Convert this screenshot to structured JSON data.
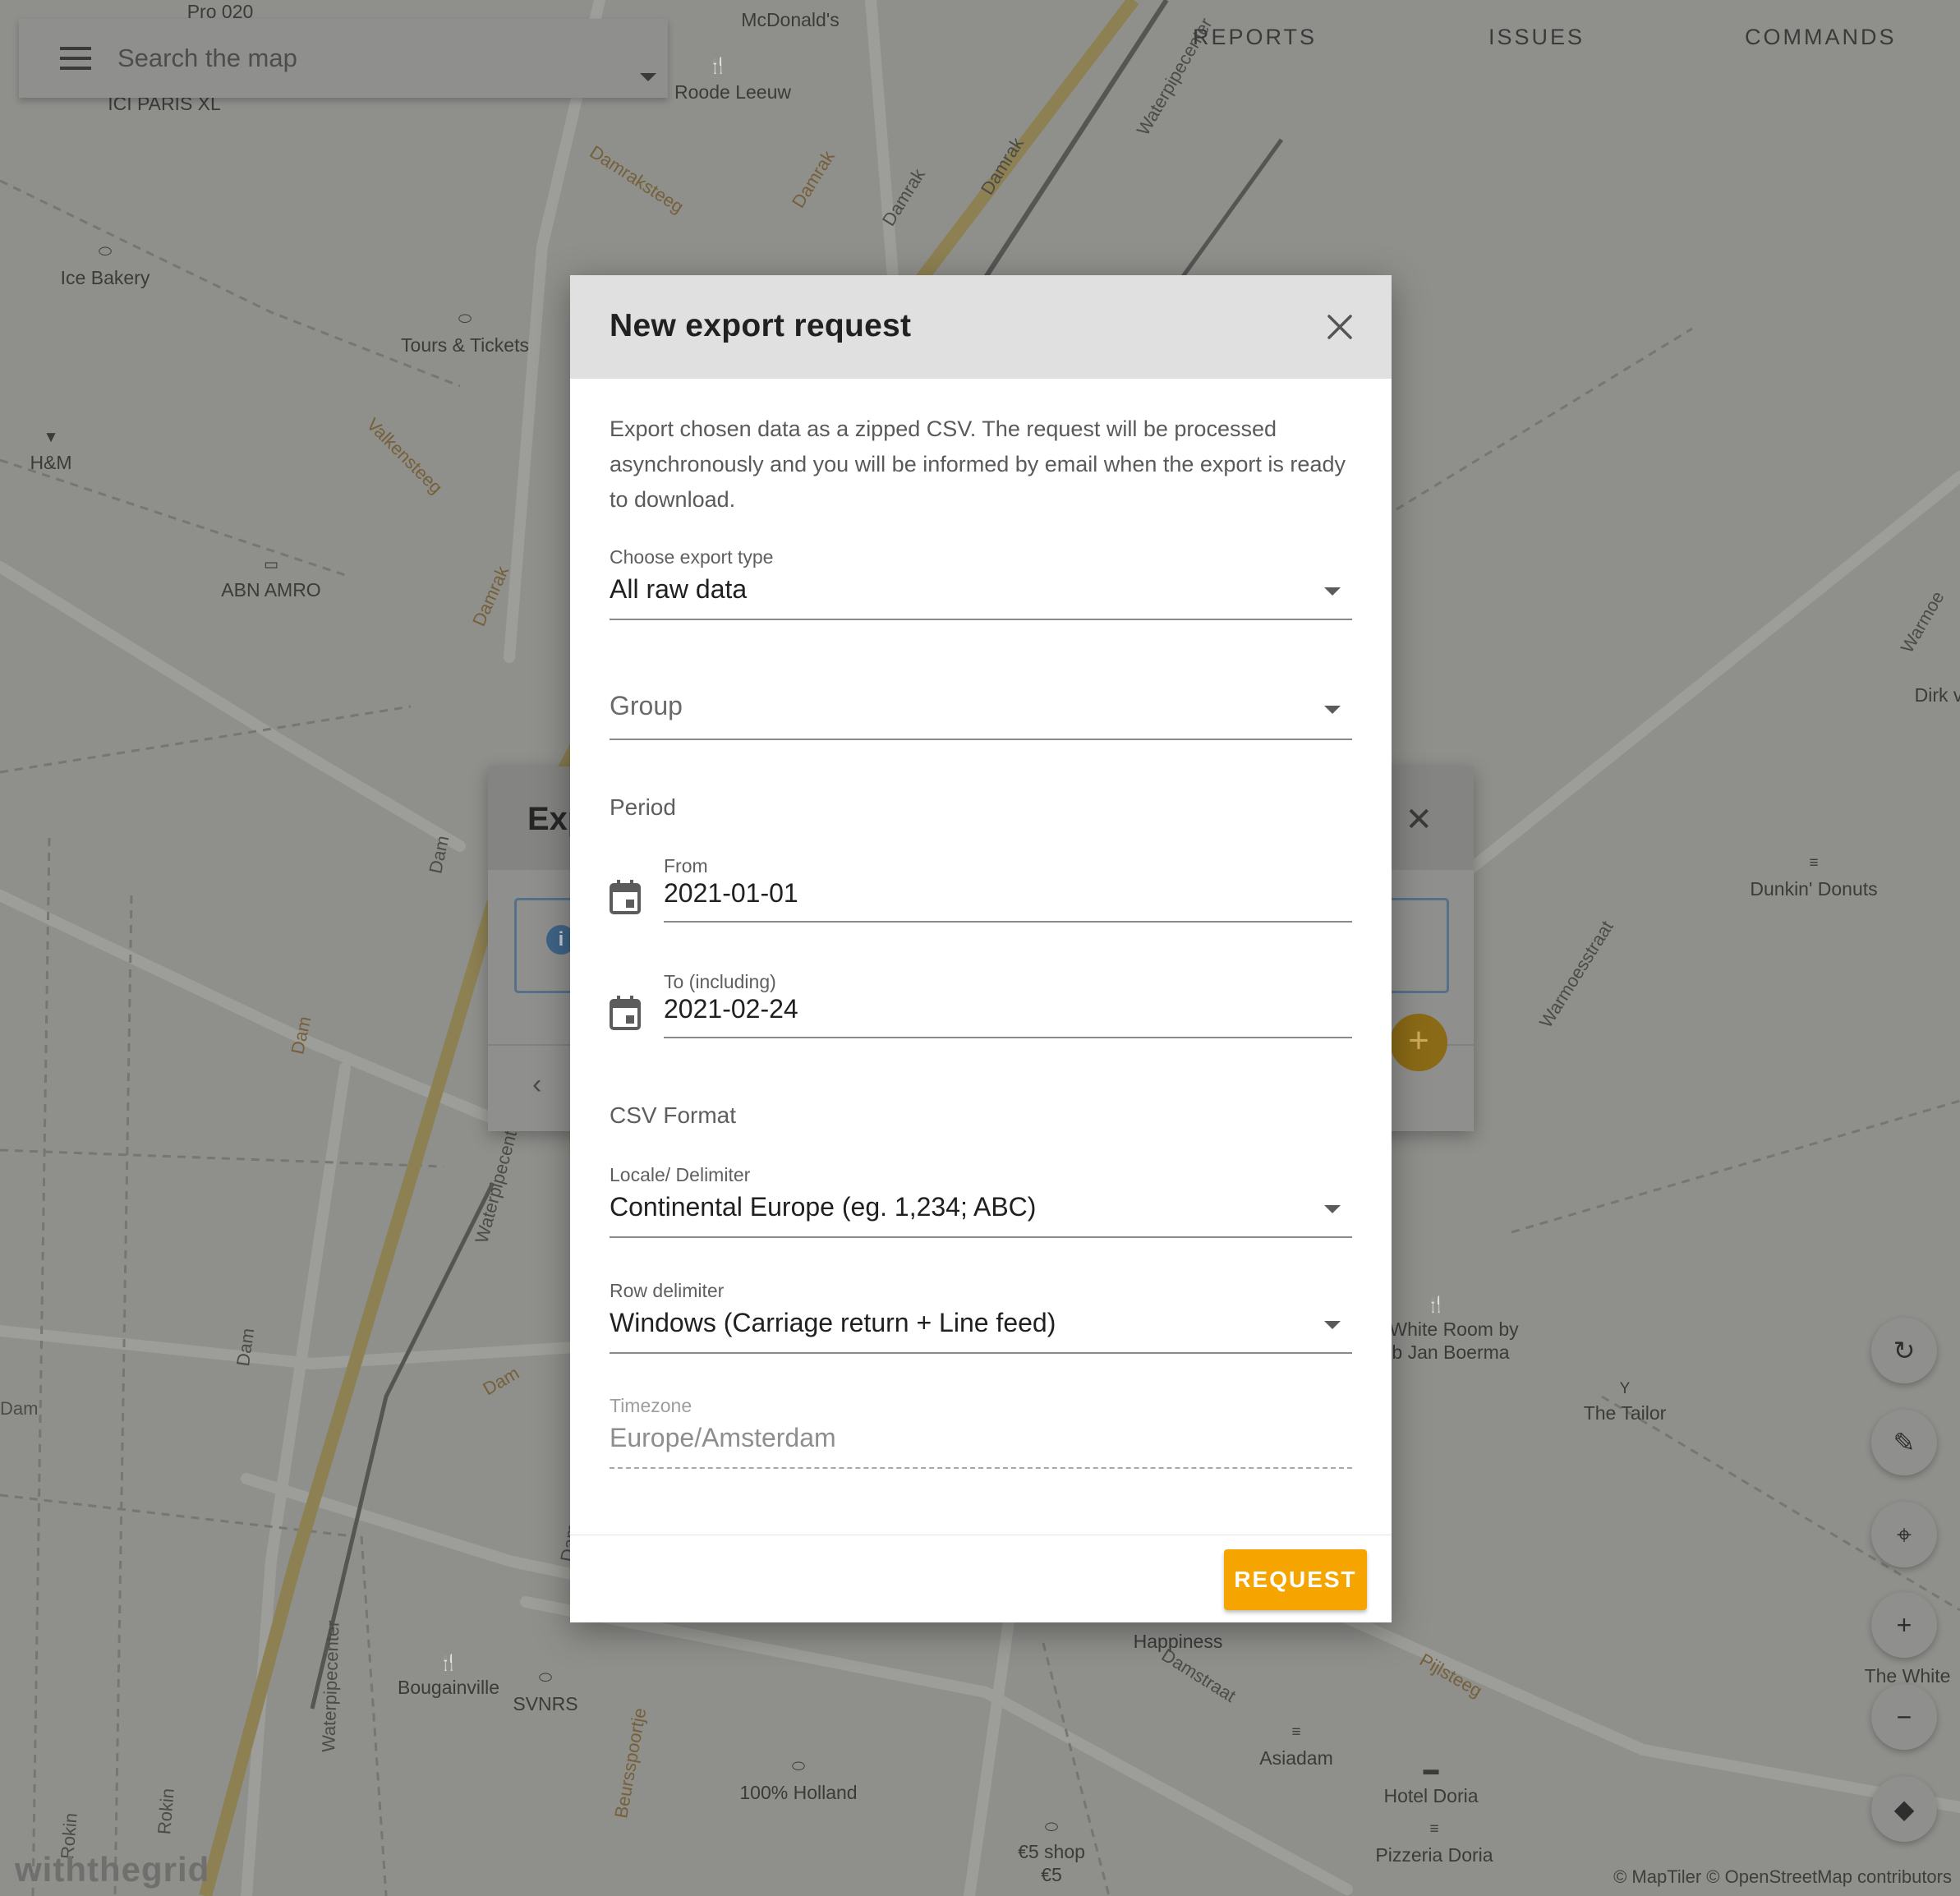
{
  "app": {
    "search_placeholder": "Search the map",
    "tabs": [
      {
        "label": "REPORTS"
      },
      {
        "label": "ISSUES"
      },
      {
        "label": "COMMANDS"
      }
    ],
    "watermark": "withthegrid",
    "attribution": "© MapTiler © OpenStreetMap contributors"
  },
  "map": {
    "pois": [
      {
        "name": "Pro 020",
        "icon": ""
      },
      {
        "name": "McDonald's",
        "icon": ""
      },
      {
        "name": "Roode Leeuw",
        "icon": "restaurant-icon"
      },
      {
        "name": "ICI PARIS XL",
        "icon": ""
      },
      {
        "name": "Ice Bakery",
        "icon": "bag-icon"
      },
      {
        "name": "Tours & Tickets",
        "icon": "bag-icon"
      },
      {
        "name": "H&M",
        "icon": "shirt-icon"
      },
      {
        "name": "ABN AMRO",
        "icon": "bank-icon"
      },
      {
        "name": "Dunkin' Donuts",
        "icon": "fastfood-icon"
      },
      {
        "name": "Dirk v",
        "icon": ""
      },
      {
        "name": "White Room by",
        "icon": "restaurant-icon"
      },
      {
        "name": "b Jan Boerma",
        "icon": ""
      },
      {
        "name": "The Tailor",
        "icon": "cocktail-icon"
      },
      {
        "name": "Happiness",
        "icon": ""
      },
      {
        "name": "Bougainville",
        "icon": "restaurant-icon"
      },
      {
        "name": "SVNRS",
        "icon": "bag-icon"
      },
      {
        "name": "100% Holland",
        "icon": "bag-icon"
      },
      {
        "name": "Asiadam",
        "icon": "fastfood-icon"
      },
      {
        "name": "Hotel Doria",
        "icon": "bed-icon"
      },
      {
        "name": "Pizzeria Doria",
        "icon": "fastfood-icon"
      },
      {
        "name": "€5 shop",
        "icon": "bag-icon"
      },
      {
        "name": "€5",
        "icon": ""
      },
      {
        "name": "The White",
        "icon": "restaurant-icon"
      }
    ],
    "streets": [
      "Damraksteeg",
      "Damrak",
      "Damrak",
      "Damrak",
      "Waterpipecenter",
      "Valkensteeg",
      "Damrak",
      "Dam",
      "Dam",
      "Dam",
      "Dam",
      "Waterpipecenter",
      "Waterpipecenter",
      "Warmoesstraat",
      "Warmoe",
      "Damstraat",
      "Pijlsteeg",
      "Rokin",
      "Rokin",
      "Beursspoortje",
      "Dam",
      "Dam"
    ]
  },
  "background_dialog": {
    "title": "Exp",
    "info_icon": "i"
  },
  "controls": [
    {
      "name": "refresh",
      "icon": "refresh-icon"
    },
    {
      "name": "edit",
      "icon": "pencil-icon"
    },
    {
      "name": "locate",
      "icon": "crosshair-icon"
    },
    {
      "name": "zoom-in",
      "icon": "plus-icon"
    },
    {
      "name": "zoom-out",
      "icon": "minus-icon"
    },
    {
      "name": "layers",
      "icon": "layers-icon"
    }
  ],
  "modal": {
    "title": "New export request",
    "description": "Export chosen data as a zipped CSV. The request will be processed asynchronously and you will be informed by email when the export is ready to download.",
    "export_type": {
      "label": "Choose export type",
      "value": "All raw data"
    },
    "group": {
      "placeholder": "Group"
    },
    "period": {
      "label": "Period",
      "from": {
        "label": "From",
        "value": "2021-01-01"
      },
      "to": {
        "label": "To (including)",
        "value": "2021-02-24"
      }
    },
    "csv_format": {
      "label": "CSV Format",
      "locale": {
        "label": "Locale/ Delimiter",
        "value": "Continental Europe (eg. 1,234; ABC)"
      },
      "row_delimiter": {
        "label": "Row delimiter",
        "value": "Windows (Carriage return + Line feed)"
      },
      "timezone": {
        "label": "Timezone",
        "value": "Europe/Amsterdam",
        "disabled": true
      }
    },
    "request_button": "REQUEST"
  },
  "colors": {
    "accent": "#f6a400",
    "header_bg": "#e0e0e0",
    "overlay_map": "#8f8f8c"
  }
}
